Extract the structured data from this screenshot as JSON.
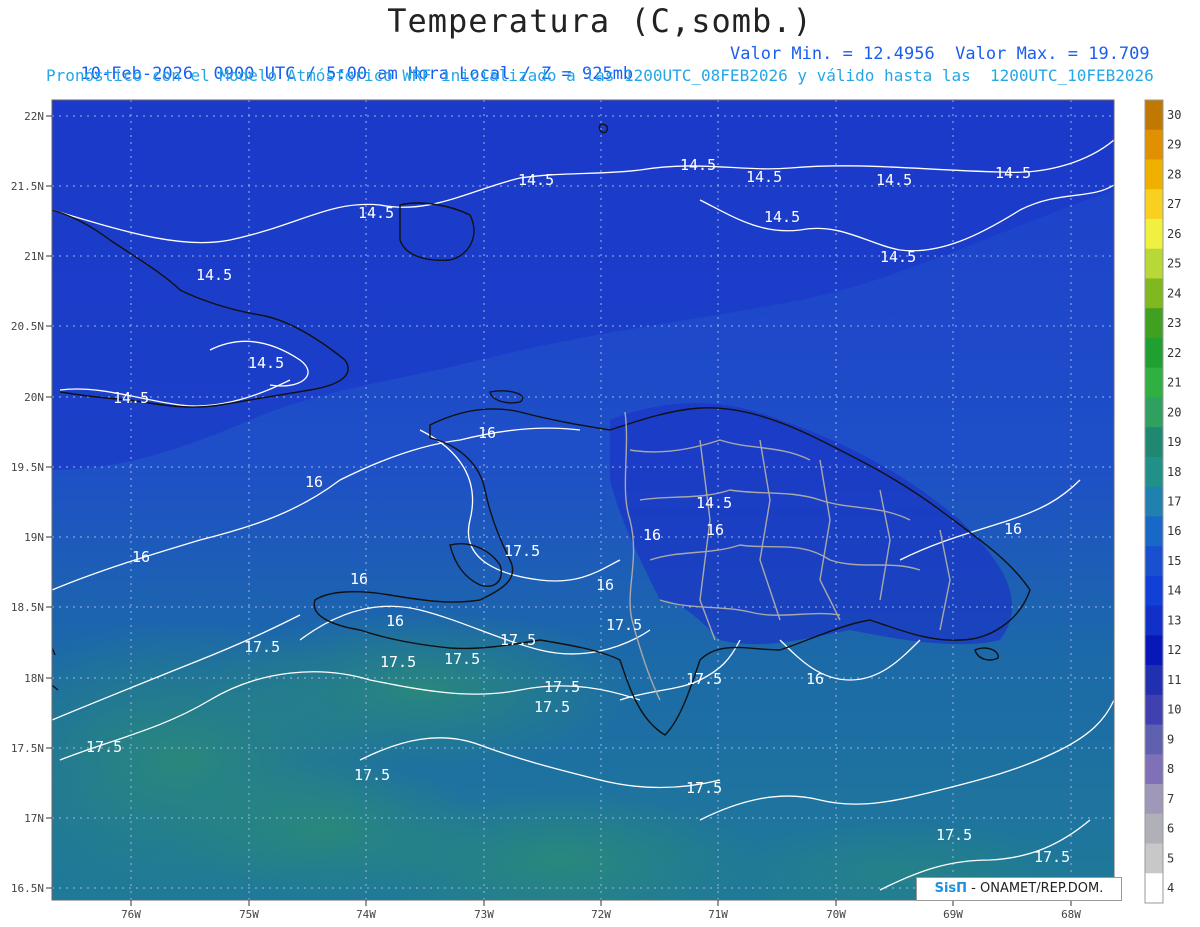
{
  "header": {
    "title": "Temperatura (C,somb.)",
    "info_left": "10-Feb-2026  0900 UTC / 5:00 am Hora Local / Z = 925mb",
    "info_right": "Valor Min. = 12.4956  Valor Max. = 19.709",
    "subtitle": "Pronóstico con el Modelo Atmósferico WRF inicializado a las 1200UTC_08FEB2026 y válido hasta las  1200UTC_10FEB2026"
  },
  "axes": {
    "lat_labels": [
      "22N",
      "21.5N",
      "21N",
      "20.5N",
      "20N",
      "19.5N",
      "19N",
      "18.5N",
      "18N",
      "17.5N",
      "17N",
      "16.5N"
    ],
    "lon_labels": [
      "76W",
      "75W",
      "74W",
      "73W",
      "72W",
      "71W",
      "70W",
      "69W",
      "68W"
    ]
  },
  "colorbar": {
    "labels": [
      "30",
      "29",
      "28",
      "27",
      "26",
      "25",
      "24",
      "23",
      "22",
      "21",
      "20",
      "19",
      "18",
      "17",
      "16",
      "15",
      "14",
      "13",
      "12",
      "11",
      "10",
      "9",
      "8",
      "7",
      "6",
      "5",
      "4"
    ],
    "colors": [
      "#c07800",
      "#e09000",
      "#f0b000",
      "#f8d020",
      "#f0f040",
      "#b8d838",
      "#80b820",
      "#40a020",
      "#20a030",
      "#30b040",
      "#30a060",
      "#208870",
      "#209088",
      "#2080b0",
      "#1868c8",
      "#1850d0",
      "#1040d8",
      "#1030c8",
      "#0818b8",
      "#2030b0",
      "#4040b0",
      "#6060b0",
      "#8070b8",
      "#a098b8",
      "#b0b0b8",
      "#c8c8c8",
      "#ffffff"
    ]
  },
  "contours": {
    "labels_14_5": [
      "14.5",
      "14.5",
      "14.5",
      "14.5",
      "14.5",
      "14.5",
      "14.5",
      "14.5",
      "14.5",
      "14.5",
      "14.5"
    ],
    "labels_16": [
      "16",
      "16",
      "16",
      "16",
      "16",
      "16",
      "16",
      "16",
      "16",
      "16"
    ],
    "labels_17_5": [
      "17.5",
      "17.5",
      "17.5",
      "17.5",
      "17.5",
      "17.5",
      "17.5",
      "17.5",
      "17.5",
      "17.5",
      "17.5",
      "17.5"
    ]
  },
  "credit": {
    "brand": "SisΠ",
    "text": "- ONAMET/REP.DOM."
  }
}
